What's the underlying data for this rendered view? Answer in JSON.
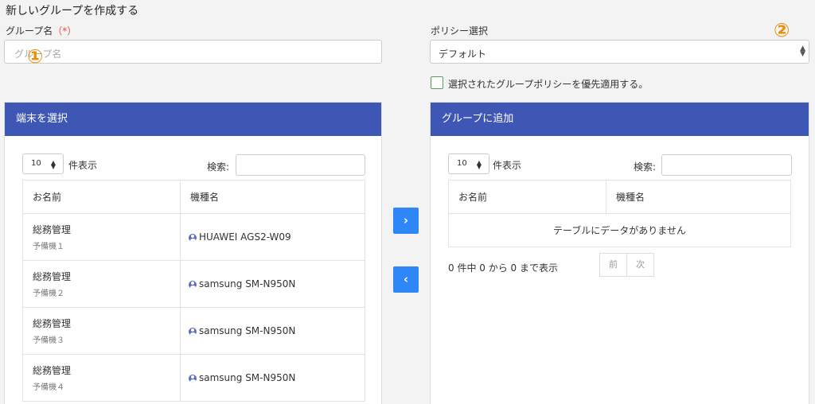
{
  "page_title": "新しいグループを作成する",
  "group_name": {
    "label": "グループ名",
    "required_mark": "（*）",
    "placeholder": "グループ名"
  },
  "markers": {
    "one": "①",
    "two": "②"
  },
  "policy": {
    "label": "ポリシー選択",
    "selected": "デフォルト",
    "checkbox_label": "選択されたグループポリシーを優先適用する。",
    "checked": false
  },
  "left_panel": {
    "header": "端末を選択",
    "length_value": "10",
    "length_label": "件表示",
    "search_label": "検索:",
    "search_value": "",
    "columns": [
      "お名前",
      "機種名"
    ],
    "rows": [
      {
        "name": "総務管理",
        "sub": "予備機１",
        "model": "HUAWEI AGS2-W09"
      },
      {
        "name": "総務管理",
        "sub": "予備機２",
        "model": "samsung SM-N950N"
      },
      {
        "name": "総務管理",
        "sub": "予備機３",
        "model": "samsung SM-N950N"
      },
      {
        "name": "総務管理",
        "sub": "予備機４",
        "model": "samsung SM-N950N"
      }
    ]
  },
  "transfer": {
    "add_icon": "chevron-right-icon",
    "remove_icon": "chevron-left-icon"
  },
  "right_panel": {
    "header": "グループに追加",
    "length_value": "10",
    "length_label": "件表示",
    "search_label": "検索:",
    "search_value": "",
    "columns": [
      "お名前",
      "機種名"
    ],
    "empty_message": "テーブルにデータがありません",
    "info": "0 件中 0 から 0 まで表示",
    "prev": "前",
    "next": "次"
  },
  "colors": {
    "panel_header": "#3f57b4",
    "arrow_button": "#2f86f6",
    "marker": "#e8900c",
    "required": "#e74c3c"
  }
}
